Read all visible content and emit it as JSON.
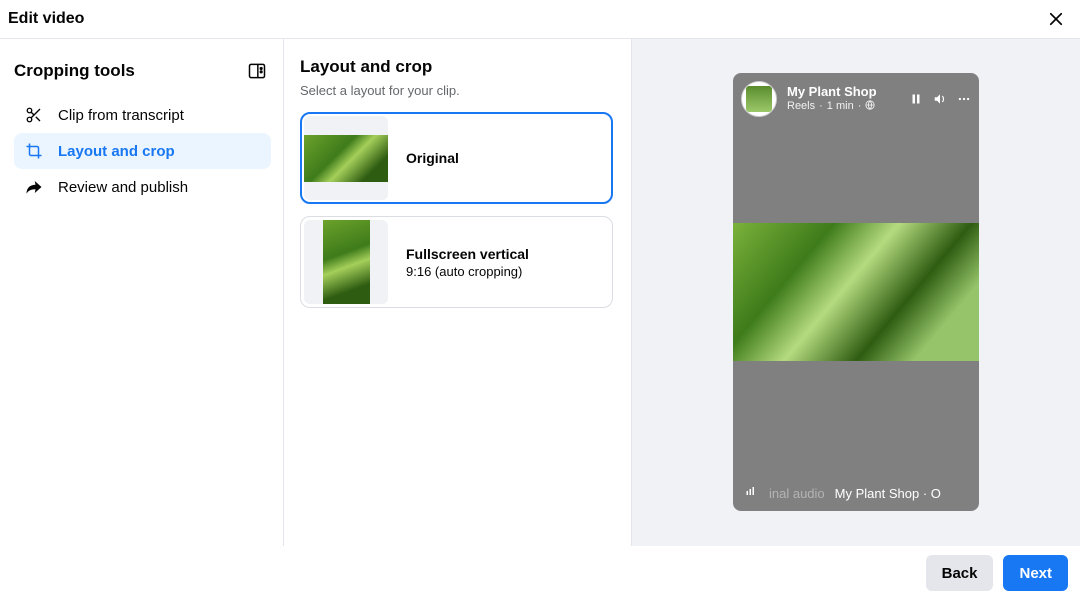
{
  "header": {
    "title": "Edit video"
  },
  "sidebar": {
    "title": "Cropping tools",
    "items": [
      {
        "label": "Clip from transcript"
      },
      {
        "label": "Layout and crop"
      },
      {
        "label": "Review and publish"
      }
    ]
  },
  "layout": {
    "title": "Layout and crop",
    "subtitle": "Select a layout for your clip.",
    "options": [
      {
        "title": "Original"
      },
      {
        "title": "Fullscreen vertical",
        "subtitle": "9:16 (auto cropping)"
      }
    ]
  },
  "preview": {
    "shop_name": "My Plant Shop",
    "reels_label": "Reels",
    "dot": "·",
    "time": "1 min",
    "audio_label": "inal audio",
    "audio_trail": "My Plant Shop · O"
  },
  "footer": {
    "back": "Back",
    "next": "Next"
  }
}
